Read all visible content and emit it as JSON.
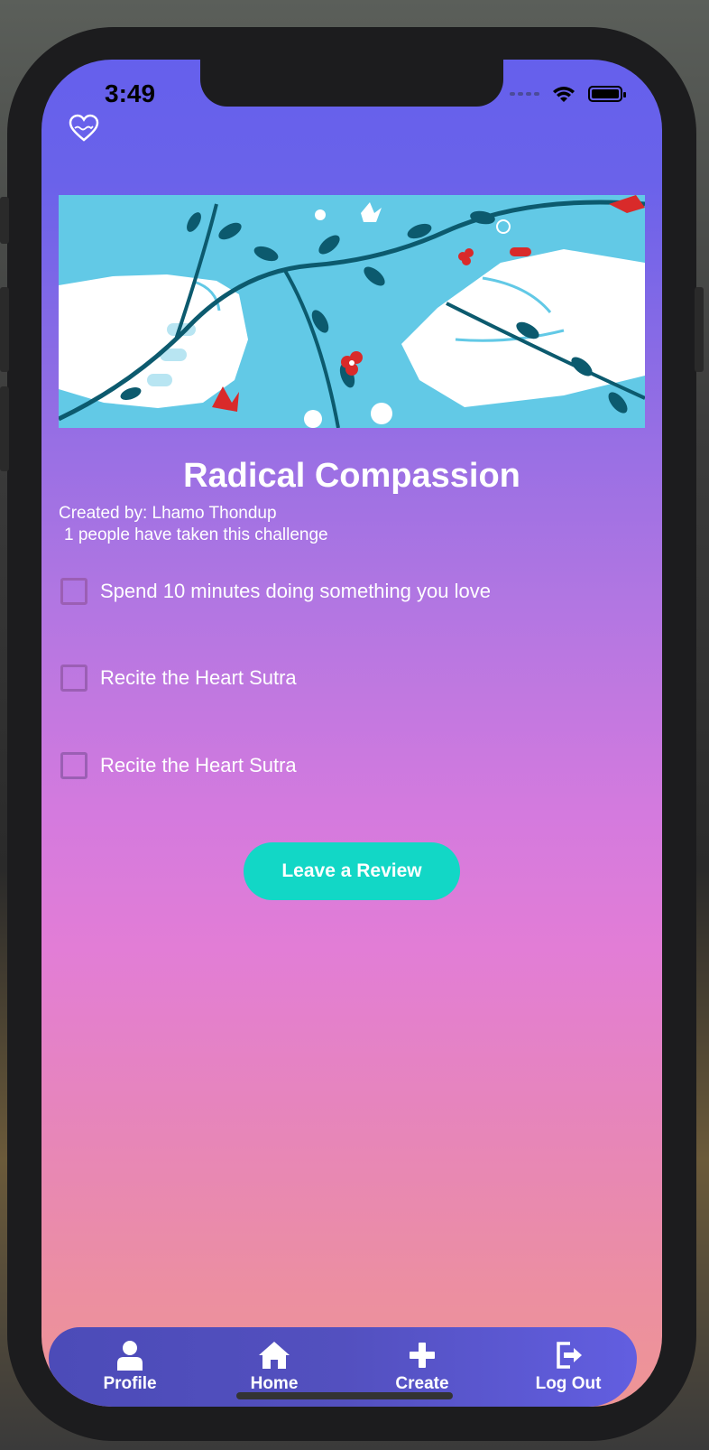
{
  "status_bar": {
    "time": "3:49"
  },
  "challenge": {
    "title": "Radical Compassion",
    "created_by": "Created by:  Lhamo Thondup",
    "participants": "1 people have taken this challenge"
  },
  "tasks": [
    {
      "label": "Spend 10 minutes doing something you love",
      "checked": false
    },
    {
      "label": "Recite the Heart Sutra",
      "checked": false
    },
    {
      "label": "Recite the Heart Sutra",
      "checked": false
    }
  ],
  "actions": {
    "review_label": "Leave a Review"
  },
  "tabbar": {
    "items": [
      {
        "label": "Profile",
        "icon": "user-icon"
      },
      {
        "label": "Home",
        "icon": "home-icon"
      },
      {
        "label": "Create",
        "icon": "plus-icon"
      },
      {
        "label": "Log Out",
        "icon": "logout-icon"
      }
    ]
  },
  "colors": {
    "accent": "#12d7c6",
    "header": "#6560ec",
    "banner_bg": "#62c9e6"
  }
}
